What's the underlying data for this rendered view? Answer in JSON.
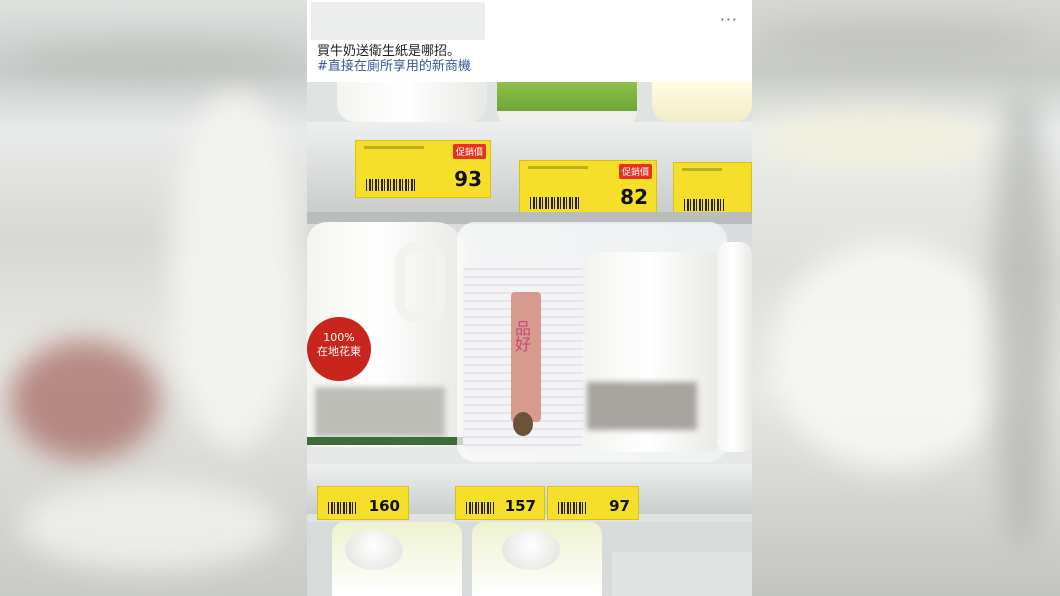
{
  "post": {
    "caption": "買牛奶送衛生紙是哪招。",
    "hashtag": "#直接在廁所享用的新商機",
    "more_label": "···"
  },
  "photo": {
    "top_shelf_tags": [
      {
        "price": "93",
        "promo": "促銷價"
      },
      {
        "price": "82",
        "promo": "促銷價"
      }
    ],
    "bottom_shelf_tags": [
      {
        "price": "160"
      },
      {
        "price": "157"
      },
      {
        "price": "97"
      }
    ],
    "milk_label": {
      "line1": "100%",
      "line2": "在地花東"
    },
    "tissue_brand": "品好"
  }
}
